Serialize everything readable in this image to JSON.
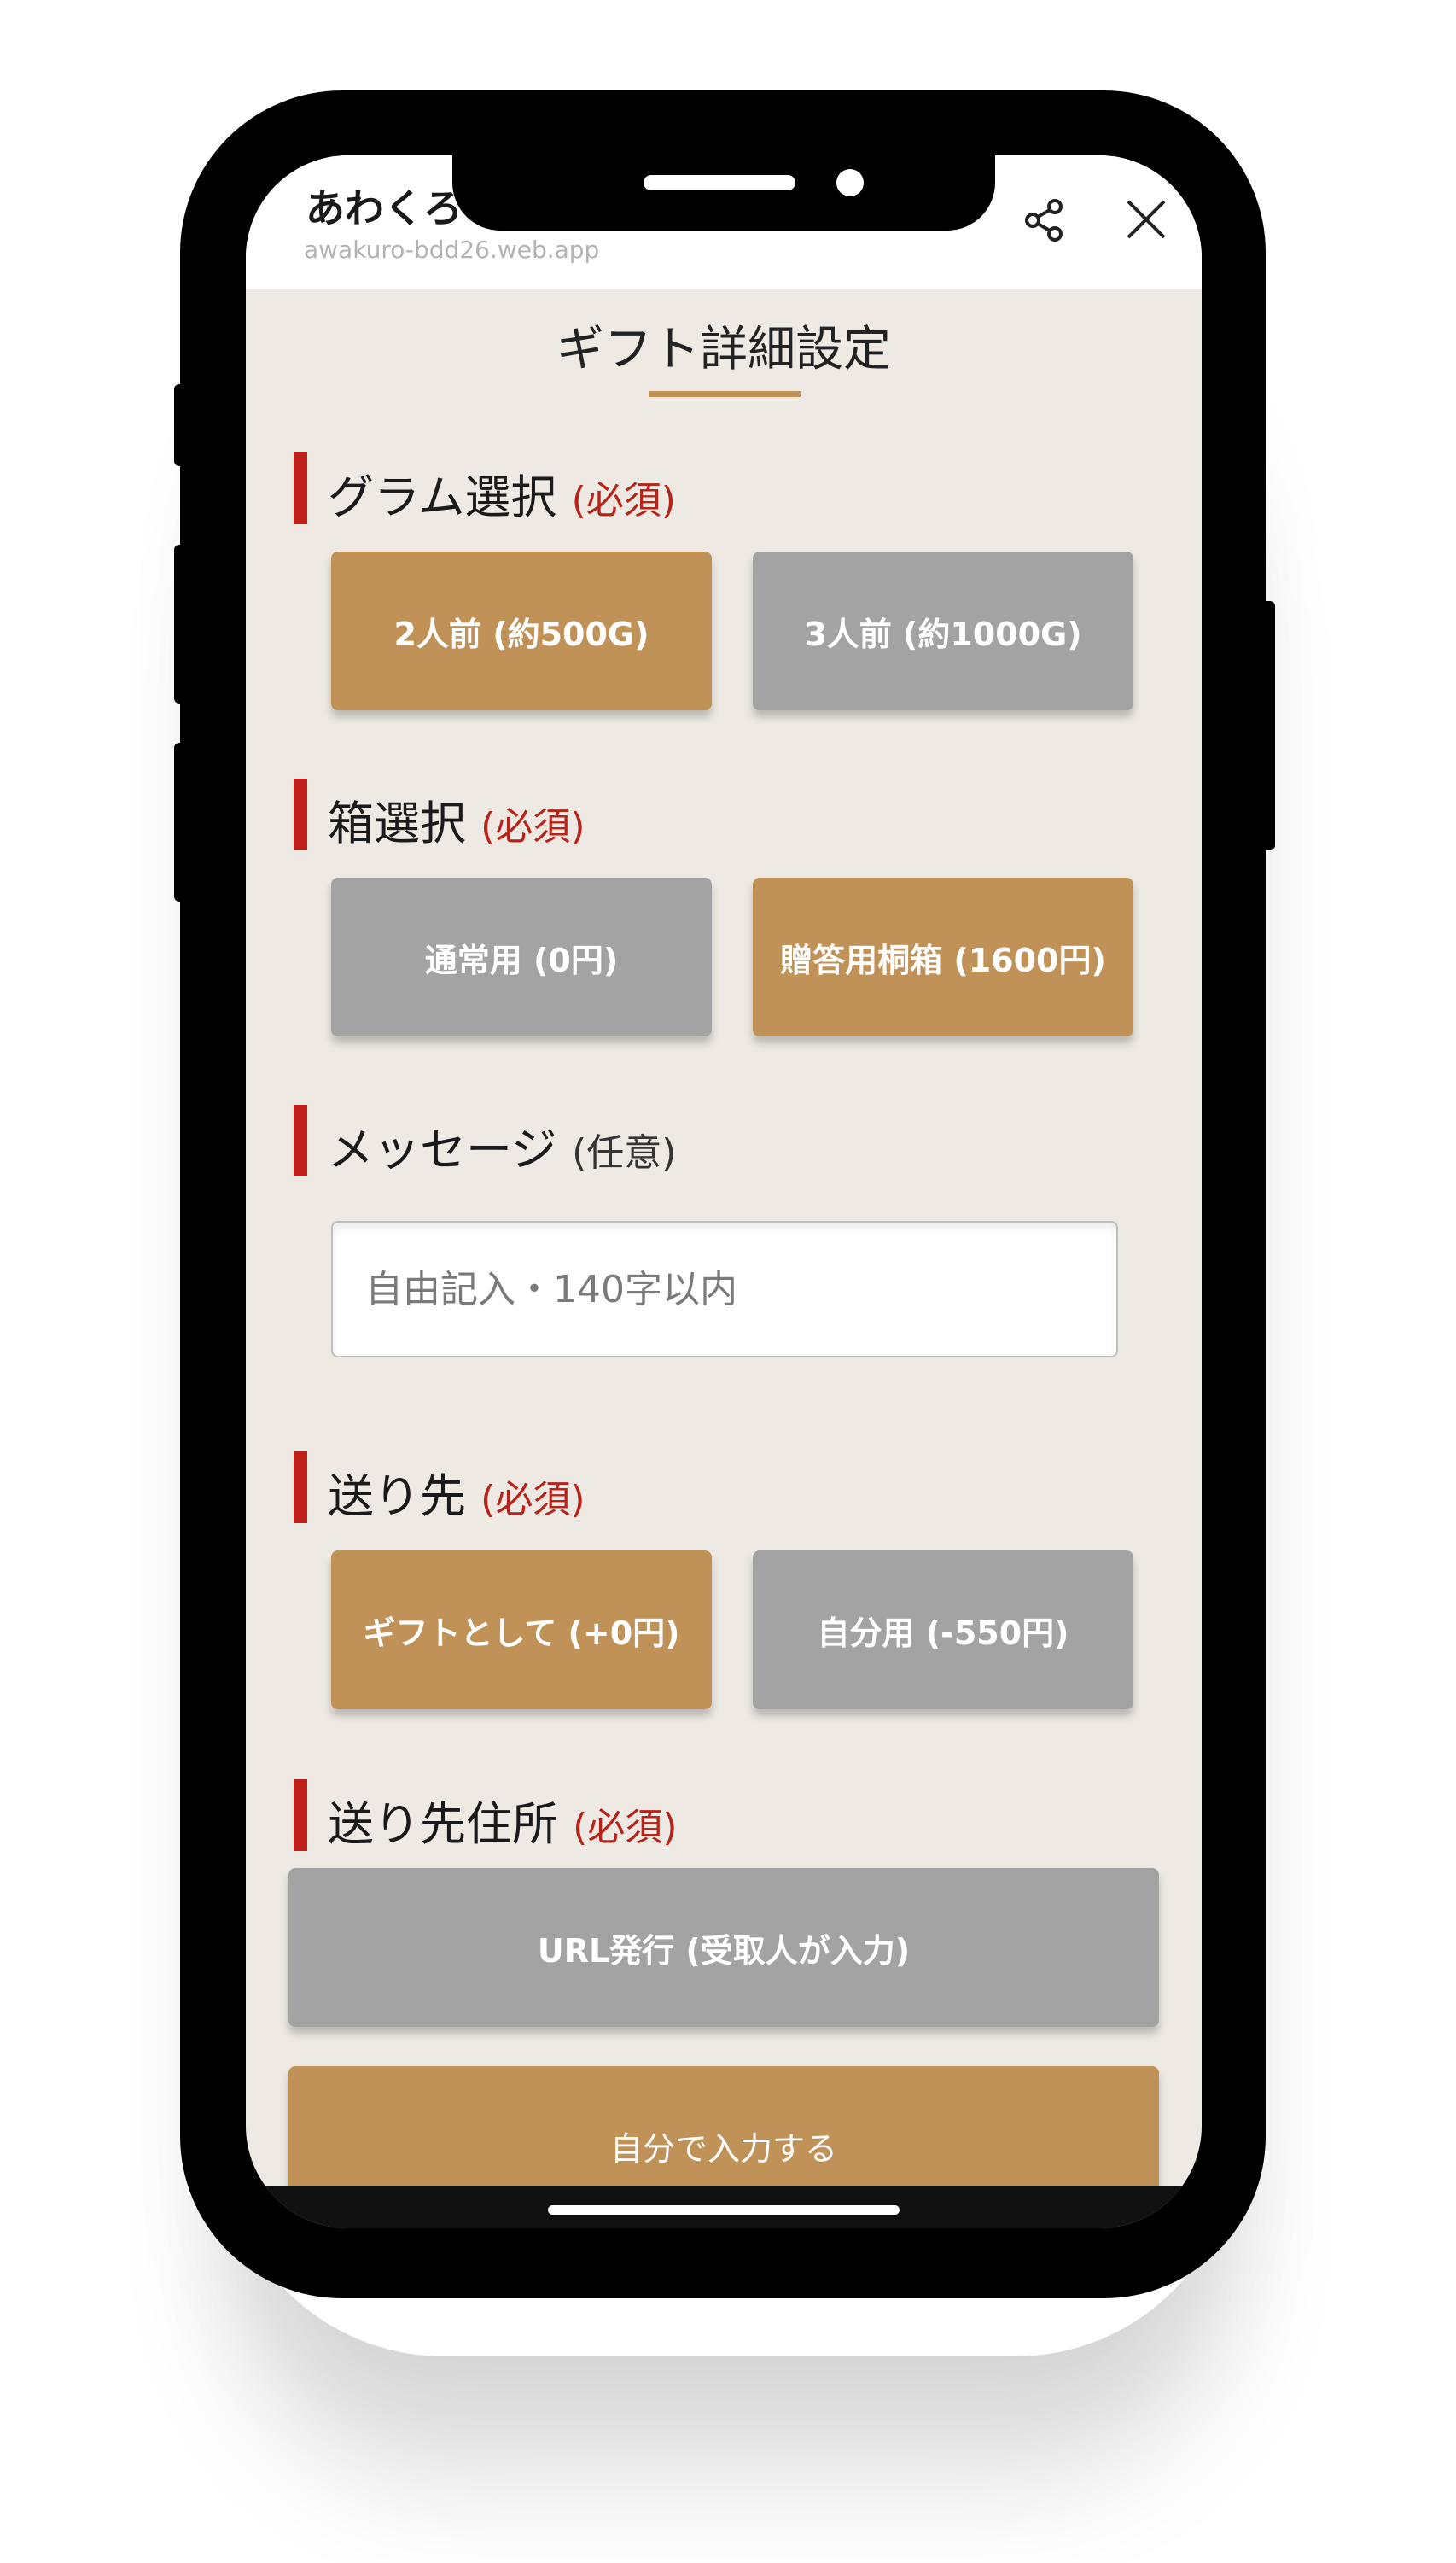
{
  "browser": {
    "title": "あわくろ",
    "url": "awakuro-bdd26.web.app",
    "share_icon": "share-icon",
    "close_icon": "close-icon"
  },
  "page": {
    "title": "ギフト詳細設定"
  },
  "sections": {
    "gram": {
      "label": "グラム選択",
      "tag": "(必須)",
      "options": [
        {
          "label": "2人前 (約500G)",
          "selected": true
        },
        {
          "label": "3人前 (約1000G)",
          "selected": false
        }
      ]
    },
    "box": {
      "label": "箱選択",
      "tag": "(必須)",
      "options": [
        {
          "label": "通常用 (0円)",
          "selected": false
        },
        {
          "label": "贈答用桐箱 (1600円)",
          "selected": true
        }
      ]
    },
    "message": {
      "label": "メッセージ",
      "tag": "(任意)",
      "placeholder": "自由記入・140字以内",
      "value": ""
    },
    "recipient": {
      "label": "送り先",
      "tag": "(必須)",
      "options": [
        {
          "label": "ギフトとして (+0円)",
          "selected": true
        },
        {
          "label": "自分用 (-550円)",
          "selected": false
        }
      ]
    },
    "address": {
      "label": "送り先住所",
      "tag": "(必須)",
      "options": [
        {
          "label": "URL発行 (受取人が入力)",
          "selected": false
        },
        {
          "label": "自分で入力する",
          "selected": true
        }
      ]
    }
  },
  "colors": {
    "selected": "#c19257",
    "unselected": "#a3a3a3",
    "required": "#b5241b",
    "accent_bar": "#c0201a",
    "background": "#eeeae3"
  }
}
